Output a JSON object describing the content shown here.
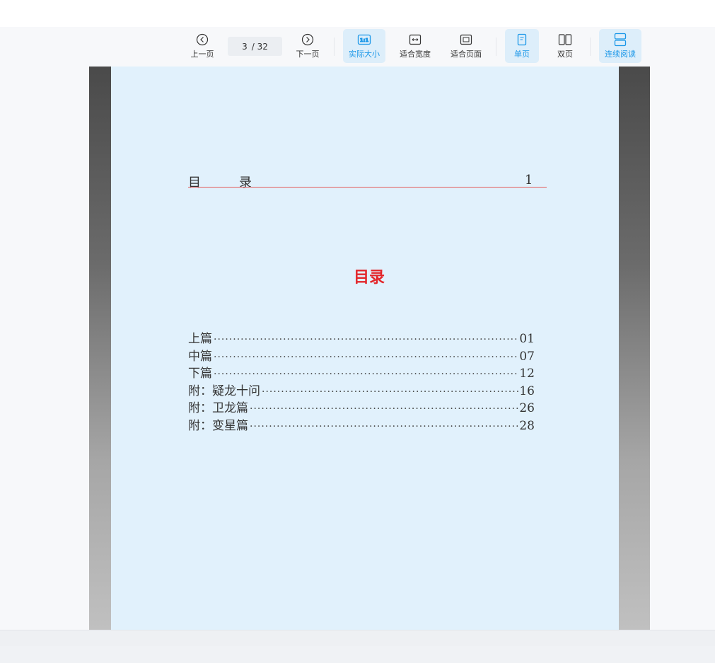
{
  "toolbar": {
    "prev_label": "上一页",
    "next_label": "下一页",
    "current_page": "3",
    "total_pages": "/ 32",
    "actual_size_label": "实际大小",
    "actual_size_icon_text": "1:1",
    "fit_width_label": "适合宽度",
    "fit_page_label": "适合页面",
    "single_page_label": "单页",
    "double_page_label": "双页",
    "continuous_label": "连续阅读",
    "accent_color": "#1a97e8"
  },
  "document": {
    "header_left_1": "目",
    "header_left_2": "录",
    "header_page_number": "1",
    "toc_title": "目录",
    "entries": [
      {
        "label": "上篇",
        "page": "01"
      },
      {
        "label": "中篇",
        "page": "07"
      },
      {
        "label": "下篇",
        "page": "12"
      },
      {
        "label": "附：疑龙十问",
        "page": "16"
      },
      {
        "label": "附：卫龙篇",
        "page": "26"
      },
      {
        "label": "附：变星篇",
        "page": "28"
      }
    ]
  }
}
